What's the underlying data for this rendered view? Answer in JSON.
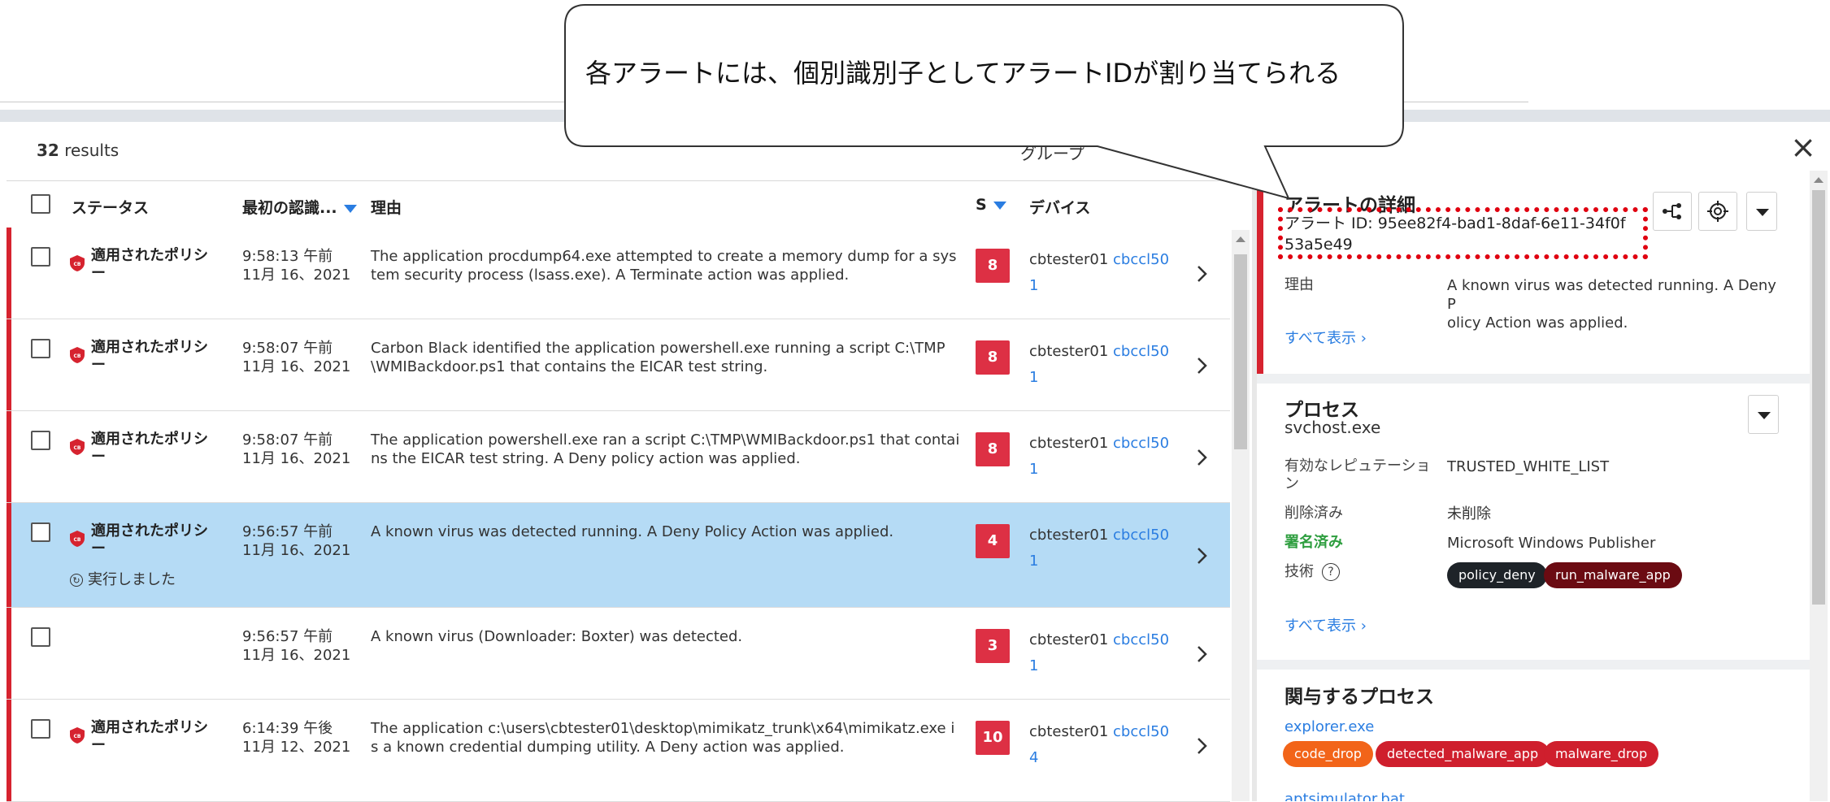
{
  "callout": {
    "text": "各アラートには、個別識別子としてアラートIDが割り当てられる"
  },
  "list": {
    "results_count": "32",
    "results_word": "results",
    "group_label": "グループ",
    "columns": {
      "status": "ステータス",
      "first_seen": "最初の認識...",
      "reason": "理由",
      "severity": "S",
      "device": "デバイス"
    },
    "rows": [
      {
        "status": "適用されたポリシー",
        "time": "9:58:13 午前",
        "date": "11月 16、2021",
        "reason": "The application procdump64.exe attempted to create a memory dump for a system security process (lsass.exe). A Terminate action was applied.",
        "severity": "8",
        "device_name": "cbtester01",
        "device_link": "cbccl50",
        "device_link2": "1"
      },
      {
        "status": "適用されたポリシー",
        "time": "9:58:07 午前",
        "date": "11月 16、2021",
        "reason": "Carbon Black identified the application powershell.exe running a script C:\\TMP\\WMIBackdoor.ps1 that contains the EICAR test string.",
        "severity": "8",
        "device_name": "cbtester01",
        "device_link": "cbccl50",
        "device_link2": "1"
      },
      {
        "status": "適用されたポリシー",
        "time": "9:58:07 午前",
        "date": "11月 16、2021",
        "reason": "The application powershell.exe ran a script C:\\TMP\\WMIBackdoor.ps1 that contains the EICAR test string. A Deny policy action was applied.",
        "severity": "8",
        "device_name": "cbtester01",
        "device_link": "cbccl50",
        "device_link2": "1"
      },
      {
        "status": "適用されたポリシー",
        "executed": "実行しました",
        "time": "9:56:57 午前",
        "date": "11月 16、2021",
        "reason": "A known virus was detected running. A Deny Policy Action was applied.",
        "severity": "4",
        "device_name": "cbtester01",
        "device_link": "cbccl50",
        "device_link2": "1"
      },
      {
        "status": "",
        "time": "9:56:57 午前",
        "date": "11月 16、2021",
        "reason": "A known virus (Downloader: Boxter) was detected.",
        "severity": "3",
        "device_name": "cbtester01",
        "device_link": "cbccl50",
        "device_link2": "1"
      },
      {
        "status": "適用されたポリシー",
        "time": "6:14:39 午後",
        "date": "11月 12、2021",
        "reason": "The application c:\\users\\cbtester01\\desktop\\mimikatz_trunk\\x64\\mimikatz.exe is a known credential dumping utility. A Deny action was applied.",
        "severity": "10",
        "device_name": "cbtester01",
        "device_link": "cbccl50",
        "device_link2": "4"
      }
    ]
  },
  "detail": {
    "title": "アラートの詳細",
    "alert_id_line1": "アラート ID: 95ee82f4-bad1-8daf-6e11-34f0f",
    "alert_id_line2": "53a5e49",
    "reason_label": "理由",
    "reason_line1": "A known virus was detected running. A Deny P",
    "reason_line2": "olicy Action was applied.",
    "show_all": "すべて表示",
    "process": {
      "title": "プロセス",
      "name": "svchost.exe",
      "reputation_label_1": "有効なレピュテーショ",
      "reputation_label_2": "ン",
      "reputation_value": "TRUSTED_WHITE_LIST",
      "deleted_label": "削除済み",
      "deleted_value": "未削除",
      "signed_label": "署名済み",
      "signed_value": "Microsoft Windows Publisher",
      "technique_label": "技術",
      "help": "?",
      "tags": [
        "policy_deny",
        "run_malware_app"
      ],
      "show_all": "すべて表示"
    },
    "involved": {
      "title": "関与するプロセス",
      "process_name": "explorer.exe",
      "tags": [
        "code_drop",
        "detected_malware_app",
        "malware_drop"
      ],
      "next_process": "aptsimulator.bat"
    }
  },
  "colors": {
    "accent": "#2a7de1",
    "danger": "#d6232f",
    "severity": "#dd3044",
    "selected": "#b5dbf5",
    "signed": "#2e9e3f"
  }
}
